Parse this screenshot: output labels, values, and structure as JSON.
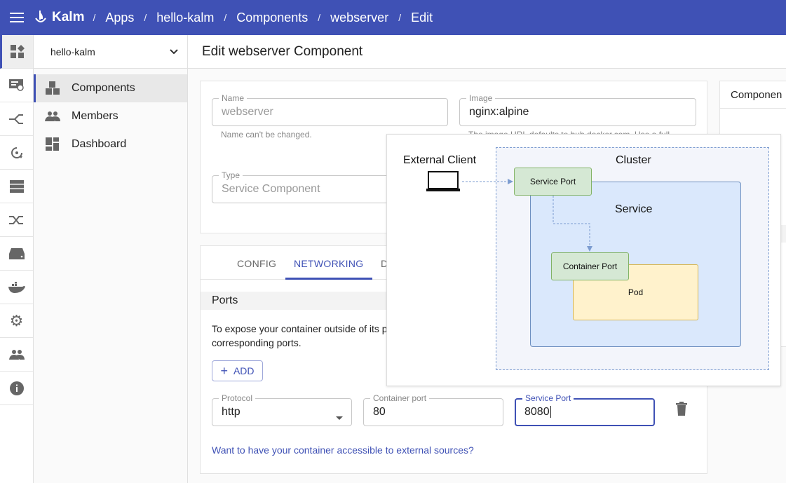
{
  "topbar": {
    "brand": "Kalm",
    "breadcrumbs": [
      "Apps",
      "hello-kalm",
      "Components",
      "webserver",
      "Edit"
    ],
    "color": "#3f51b5"
  },
  "rail": {
    "icons": [
      "dashboard-icon",
      "certificate-icon",
      "routes-icon",
      "deploy-key-icon",
      "nodes-icon",
      "load-balancer-icon",
      "disks-icon",
      "docker-registry-icon",
      "settings-icon",
      "members-icon",
      "about-icon"
    ]
  },
  "sidebar": {
    "app_selector": "hello-kalm",
    "items": [
      {
        "label": "Components",
        "icon": "components-icon"
      },
      {
        "label": "Members",
        "icon": "members-icon"
      },
      {
        "label": "Dashboard",
        "icon": "dashboard-icon"
      }
    ]
  },
  "page": {
    "title": "Edit webserver Component"
  },
  "basic": {
    "name": {
      "label": "Name",
      "value": "webserver",
      "help": "Name can't be changed."
    },
    "image": {
      "label": "Image",
      "value": "nginx:alpine",
      "help": "The image URL defaults to hub.docker.com. Use a full"
    },
    "type": {
      "label": "Type",
      "value": "Service Component"
    }
  },
  "right_card": {
    "title": "Componen"
  },
  "tabs": [
    "CONFIG",
    "NETWORKING",
    "D"
  ],
  "active_tab": "NETWORKING",
  "ports": {
    "title": "Ports",
    "description": "To expose your container outside of its p",
    "description2": "corresponding ports.",
    "add_label": "ADD",
    "protocol": {
      "label": "Protocol",
      "value": "http"
    },
    "container_port": {
      "label": "Container port",
      "value": "80"
    },
    "service_port": {
      "label": "Service Port",
      "value": "8080"
    },
    "external_link": "Want to have your container accessible to external sources?"
  },
  "diagram": {
    "external_client": "External Client",
    "cluster": "Cluster",
    "service_port": "Service Port",
    "service": "Service",
    "container_port": "Container Port",
    "pod": "Pod"
  }
}
